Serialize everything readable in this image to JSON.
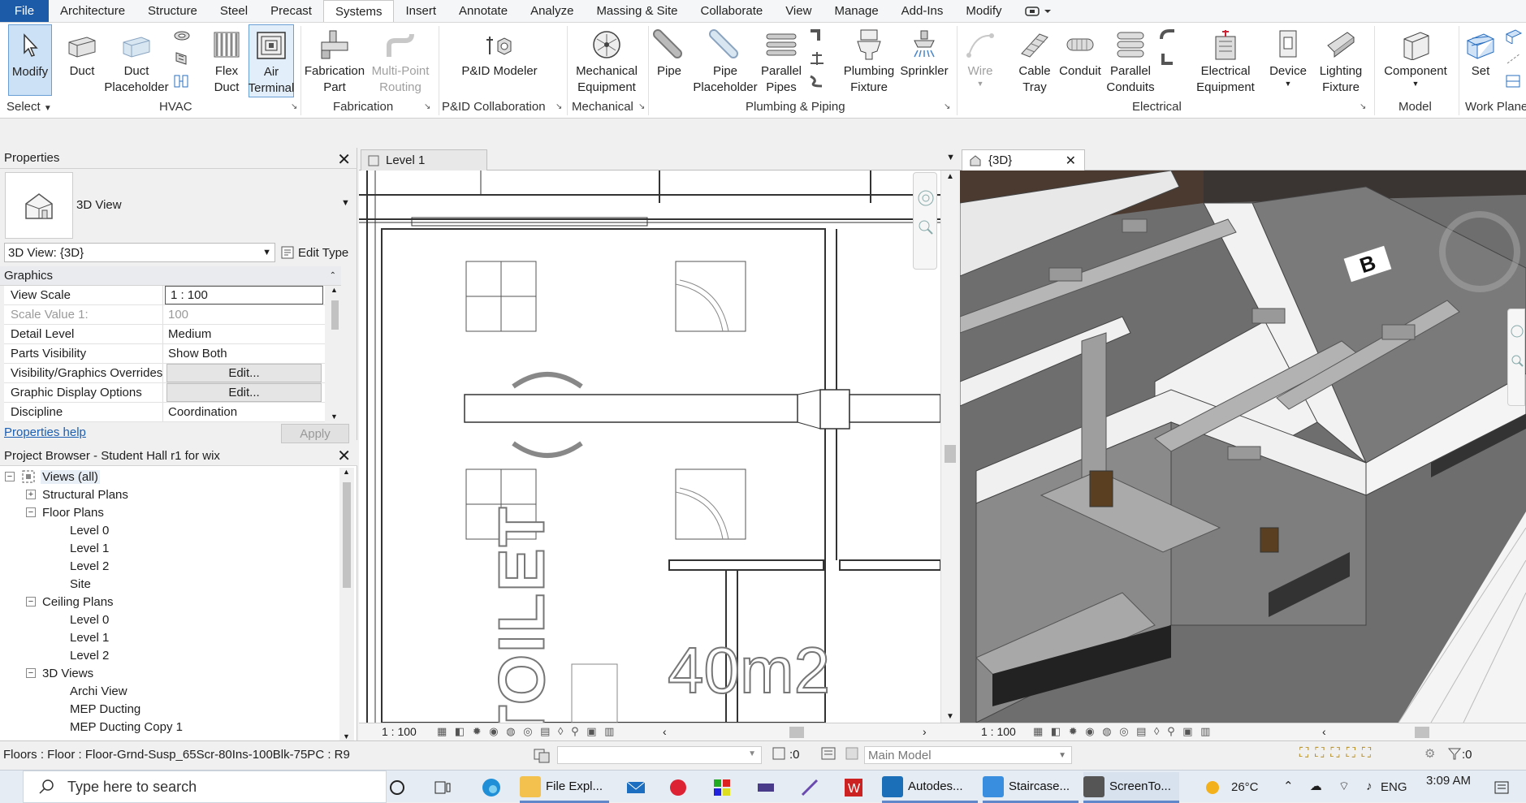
{
  "menubar": {
    "file": "File",
    "items": [
      "Architecture",
      "Structure",
      "Steel",
      "Precast",
      "Systems",
      "Insert",
      "Annotate",
      "Analyze",
      "Massing & Site",
      "Collaborate",
      "View",
      "Manage",
      "Add-Ins",
      "Modify"
    ],
    "active": "Systems"
  },
  "ribbon": {
    "modify": "Modify",
    "duct": "Duct",
    "duct_placeholder_1": "Duct",
    "duct_placeholder_2": "Placeholder",
    "flex_duct_1": "Flex",
    "flex_duct_2": "Duct",
    "air_terminal_1": "Air",
    "air_terminal_2": "Terminal",
    "fabrication_part_1": "Fabrication",
    "fabrication_part_2": "Part",
    "multipoint_1": "Multi-Point",
    "multipoint_2": "Routing",
    "pid_modeler": "P&ID Modeler",
    "mech_equip_1": "Mechanical",
    "mech_equip_2": "Equipment",
    "pipe": "Pipe",
    "pipe_placeholder_1": "Pipe",
    "pipe_placeholder_2": "Placeholder",
    "parallel_pipes_1": "Parallel",
    "parallel_pipes_2": "Pipes",
    "plumbing_fixture_1": "Plumbing",
    "plumbing_fixture_2": "Fixture",
    "sprinkler": "Sprinkler",
    "wire": "Wire",
    "cable_tray_1": "Cable",
    "cable_tray_2": "Tray",
    "conduit": "Conduit",
    "parallel_conduits_1": "Parallel",
    "parallel_conduits_2": "Conduits",
    "elec_equip_1": "Electrical",
    "elec_equip_2": "Equipment",
    "device": "Device",
    "lighting_fixture_1": "Lighting",
    "lighting_fixture_2": "Fixture",
    "component": "Component",
    "set": "Set",
    "panels": {
      "select": "Select",
      "hvac": "HVAC",
      "fabrication": "Fabrication",
      "pid": "P&ID Collaboration",
      "mechanical": "Mechanical",
      "plumbing": "Plumbing & Piping",
      "electrical": "Electrical",
      "model": "Model",
      "work_plane": "Work Plane"
    }
  },
  "properties": {
    "title": "Properties",
    "type_name": "3D View",
    "selector": "3D View: {3D}",
    "edit_type": "Edit Type",
    "group": "Graphics",
    "rows": [
      {
        "k": "View Scale",
        "v": "1 : 100"
      },
      {
        "k": "Scale Value    1:",
        "v": "100"
      },
      {
        "k": "Detail Level",
        "v": "Medium"
      },
      {
        "k": "Parts Visibility",
        "v": "Show Both"
      },
      {
        "k": "Visibility/Graphics Overrides",
        "v": "Edit..."
      },
      {
        "k": "Graphic Display Options",
        "v": "Edit..."
      },
      {
        "k": "Discipline",
        "v": "Coordination"
      }
    ],
    "help": "Properties help",
    "apply": "Apply"
  },
  "browser": {
    "title": "Project Browser - Student Hall r1 for wix",
    "items": [
      {
        "label": "Views (all)",
        "level": 0,
        "toggle": "−"
      },
      {
        "label": "Structural Plans",
        "level": 1,
        "toggle": "+"
      },
      {
        "label": "Floor Plans",
        "level": 1,
        "toggle": "−"
      },
      {
        "label": "Level 0",
        "level": 2
      },
      {
        "label": "Level 1",
        "level": 2
      },
      {
        "label": "Level 2",
        "level": 2
      },
      {
        "label": "Site",
        "level": 2
      },
      {
        "label": "Ceiling Plans",
        "level": 1,
        "toggle": "−"
      },
      {
        "label": "Level 0",
        "level": 2
      },
      {
        "label": "Level 1",
        "level": 2
      },
      {
        "label": "Level 2",
        "level": 2
      },
      {
        "label": "3D Views",
        "level": 1,
        "toggle": "−"
      },
      {
        "label": "Archi View",
        "level": 2
      },
      {
        "label": "MEP Ducting",
        "level": 2
      },
      {
        "label": "MEP Ducting Copy 1",
        "level": 2
      }
    ]
  },
  "plan_view": {
    "tab": "Level 1",
    "room_name": "TOILET",
    "area": "40m2",
    "scale": "1 : 100"
  },
  "td_view": {
    "tab": "{3D}",
    "label": "B",
    "scale": "1 : 100"
  },
  "statusbar": {
    "text": "Floors : Floor : Floor-Grnd-Susp_65Scr-80Ins-100Blk-75PC : R9",
    "count": ":0",
    "workset": "Main Model",
    "filter": ":0"
  },
  "taskbar": {
    "search": "Type here to search",
    "apps": [
      "File Expl...",
      "Autodes...",
      "Staircase...",
      "ScreenTo..."
    ],
    "temperature": "26°C",
    "lang": "ENG",
    "time": "3:09 AM"
  },
  "colors": {
    "accent": "#1c5ba8",
    "selected": "#cce0f6",
    "viewport_bg": "#6a6a6a"
  }
}
